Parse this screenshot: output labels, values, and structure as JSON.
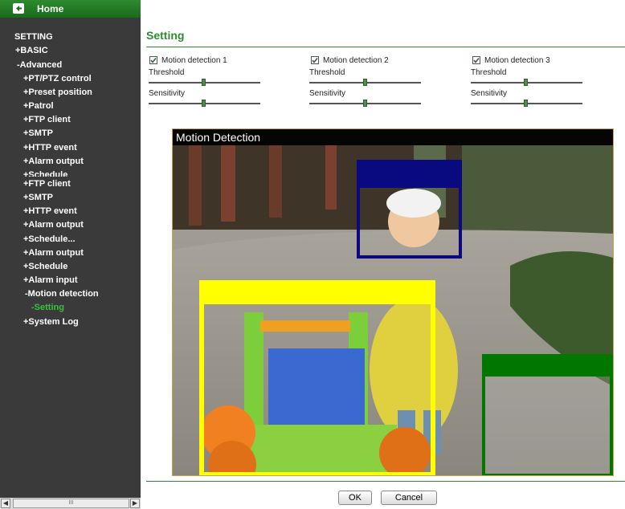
{
  "sidebar": {
    "home_label": "Home",
    "items": [
      {
        "label": "SETTING",
        "active": false
      },
      {
        "label": "+BASIC",
        "active": false
      },
      {
        "label": "-Advanced",
        "active": false
      },
      {
        "label": "+PT/PTZ control",
        "active": false
      },
      {
        "label": "+Preset position",
        "active": false
      },
      {
        "label": "+Patrol",
        "active": false
      },
      {
        "label": "+FTP client",
        "active": false
      },
      {
        "label": "+SMTP",
        "active": false
      },
      {
        "label": "+HTTP event",
        "active": false
      },
      {
        "label": "+Alarm output",
        "active": false
      },
      {
        "label": "+Schedule",
        "active": false
      },
      {
        "label": "+FTP client",
        "active": false
      },
      {
        "label": "+SMTP",
        "active": false
      },
      {
        "label": "+HTTP event",
        "active": false
      },
      {
        "label": "+Alarm output",
        "active": false
      },
      {
        "label": "+Schedule...",
        "active": false
      },
      {
        "label": "+Alarm output",
        "active": false
      },
      {
        "label": "+Schedule",
        "active": false
      },
      {
        "label": "+Alarm input",
        "active": false
      },
      {
        "label": "-Motion detection",
        "active": false
      },
      {
        "label": "-Setting",
        "active": true
      },
      {
        "label": "+System Log",
        "active": false
      }
    ],
    "scrollbar_thumb": "III"
  },
  "main": {
    "title": "Setting",
    "threshold_label": "Threshold",
    "sensitivity_label": "Sensitivity",
    "detections": [
      {
        "label": "Motion detection 1",
        "checked": true,
        "threshold": 0.5,
        "sensitivity": 0.5
      },
      {
        "label": "Motion detection 2",
        "checked": true,
        "threshold": 0.5,
        "sensitivity": 0.5
      },
      {
        "label": "Motion detection 3",
        "checked": true,
        "threshold": 0.5,
        "sensitivity": 0.5
      }
    ],
    "video_title": "Motion Detection",
    "zone_colors": [
      "#0a0a80",
      "#ffff00",
      "#007800"
    ]
  },
  "buttons": {
    "ok": "OK",
    "cancel": "Cancel"
  },
  "colors": {
    "accent": "#2e8b2e",
    "sidebar_bg": "#3a3a3a",
    "active_item": "#39c339"
  }
}
